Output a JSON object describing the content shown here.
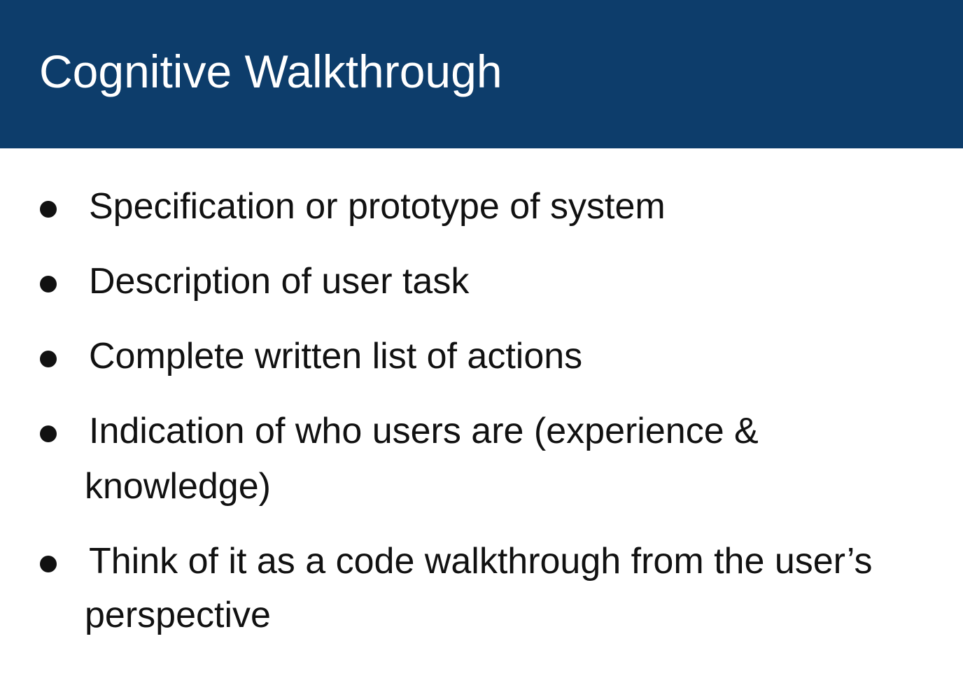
{
  "slide": {
    "title": "Cognitive Walkthrough",
    "colors": {
      "title_bar": "#0d3d6b",
      "title_text": "#ffffff",
      "body_text": "#111111",
      "background": "#ffffff"
    },
    "bullets": [
      {
        "line1": "Specification or prototype of system",
        "line2": ""
      },
      {
        "line1": "Description of user task",
        "line2": ""
      },
      {
        "line1": "Complete written list of actions",
        "line2": ""
      },
      {
        "line1": "Indication of who users are (experience &",
        "line2": "knowledge)"
      },
      {
        "line1": "Think of it as a code walkthrough from the user’s",
        "line2": "perspective"
      }
    ]
  }
}
